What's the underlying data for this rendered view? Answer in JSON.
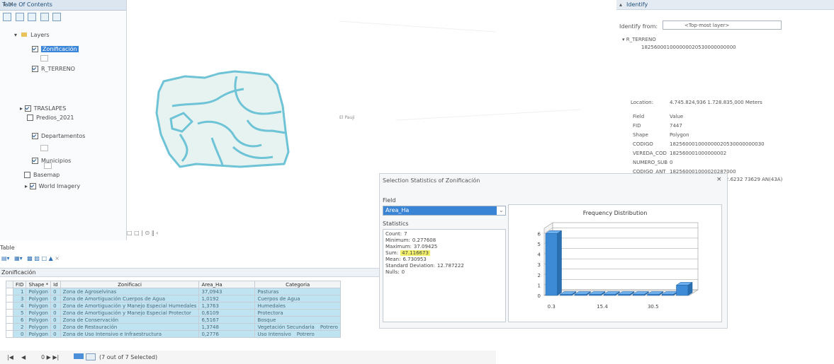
{
  "toc": {
    "title": "Table Of Contents",
    "pin": "↓ ×",
    "root": "Layers",
    "layers": [
      {
        "label": "Zonificación",
        "checked": true,
        "selected": true
      },
      {
        "label": "R_TERRENO",
        "checked": true
      },
      {
        "label": "TRASLAPES",
        "checked": true
      },
      {
        "label": "Predios_2021",
        "checked": false
      },
      {
        "label": "Departamentos",
        "checked": true
      },
      {
        "label": "Municipios",
        "checked": true
      },
      {
        "label": "Basemap",
        "checked": false
      },
      {
        "label": "World Imagery",
        "checked": true
      }
    ]
  },
  "map": {
    "place_label": "El Pauji",
    "bottom_controls": "□ □ | ⊙ ‖ ‹"
  },
  "identify": {
    "title": "Identify",
    "from_label": "Identify from:",
    "from_value": "<Top-most layer>",
    "tree_layer": "R_TERRENO",
    "tree_value": "182560001000000020530000000000",
    "location_label": "Location:",
    "location_value": "4.745.824,936  1.728.835,000 Meters",
    "field_header": "Field",
    "value_header": "Value",
    "rows": [
      {
        "field": "FID",
        "value": "7447"
      },
      {
        "field": "Shape",
        "value": "Polygon"
      },
      {
        "field": "CODIGO",
        "value": "182560001000000020530000000030"
      },
      {
        "field": "VEREDA_COD",
        "value": "182560001000000002"
      },
      {
        "field": "NUMERO_SUB",
        "value": "0"
      },
      {
        "field": "CODIGO_ANT",
        "value": "182560001000020287000"
      }
    ],
    "extra": "€52.6232 73629 AN(43A)"
  },
  "table": {
    "title": "Table",
    "layer_name": "Zonificación",
    "columns": [
      "FID",
      "Shape *",
      "Id",
      "Zonificaci",
      "Area_Ha",
      "Categoria"
    ],
    "rows": [
      [
        "1",
        "Polygon",
        "0",
        "Zona de Agroselvinas",
        "37,0943",
        "Pasturas"
      ],
      [
        "3",
        "Polygon",
        "0",
        "Zona de Amortiguación Cuerpos de Agua",
        "1,0192",
        "Cuerpos de Agua"
      ],
      [
        "4",
        "Polygon",
        "0",
        "Zona de Amortiguación y Manejo Especial Humedales",
        "1,3763",
        "Humedales"
      ],
      [
        "5",
        "Polygon",
        "0",
        "Zona de Amortiguación y Manejo Especial Protector",
        "0,6109",
        "Protectora"
      ],
      [
        "6",
        "Polygon",
        "0",
        "Zona de Conservación",
        "6,5167",
        "Bosque"
      ],
      [
        "2",
        "Polygon",
        "0",
        "Zona de Restauración",
        "1,3748",
        "Vegetación Secundaria",
        "Potrero"
      ],
      [
        "0",
        "Polygon",
        "0",
        "Zona de Uso Intensivo e Infraestructura",
        "0,2776",
        "Uso Intensivo",
        "Potrero"
      ]
    ],
    "status": "0  ▶ ▶|",
    "status_text": "(7 out of 7 Selected)"
  },
  "stats": {
    "title": "Selection Statistics of Zonificación",
    "close": "×",
    "field_label": "Field",
    "field_value": "Area_Ha",
    "stats_label": "Statistics",
    "items": [
      {
        "k": "Count:",
        "v": "7"
      },
      {
        "k": "Minimum:",
        "v": "0.277608"
      },
      {
        "k": "Maximum:",
        "v": "37.09425"
      },
      {
        "k": "Sum:",
        "v": "47.116673"
      },
      {
        "k": "Mean:",
        "v": "6.730953"
      },
      {
        "k": "Standard Deviation:",
        "v": "12.787222"
      },
      {
        "k": "Nulls:",
        "v": "0"
      }
    ],
    "chart_title": "Frequency Distribution"
  },
  "chart_data": {
    "type": "bar",
    "title": "Frequency Distribution",
    "values": [
      6,
      0,
      0,
      0,
      0,
      0,
      0,
      0,
      0,
      1
    ],
    "x_ticks": [
      "0.3",
      "15.4",
      "30.5"
    ],
    "y_ticks": [
      "0",
      "1",
      "2",
      "3",
      "4",
      "5",
      "6"
    ],
    "ylim": [
      0,
      6.5
    ],
    "grid": true,
    "color": "#3d8bd6"
  }
}
